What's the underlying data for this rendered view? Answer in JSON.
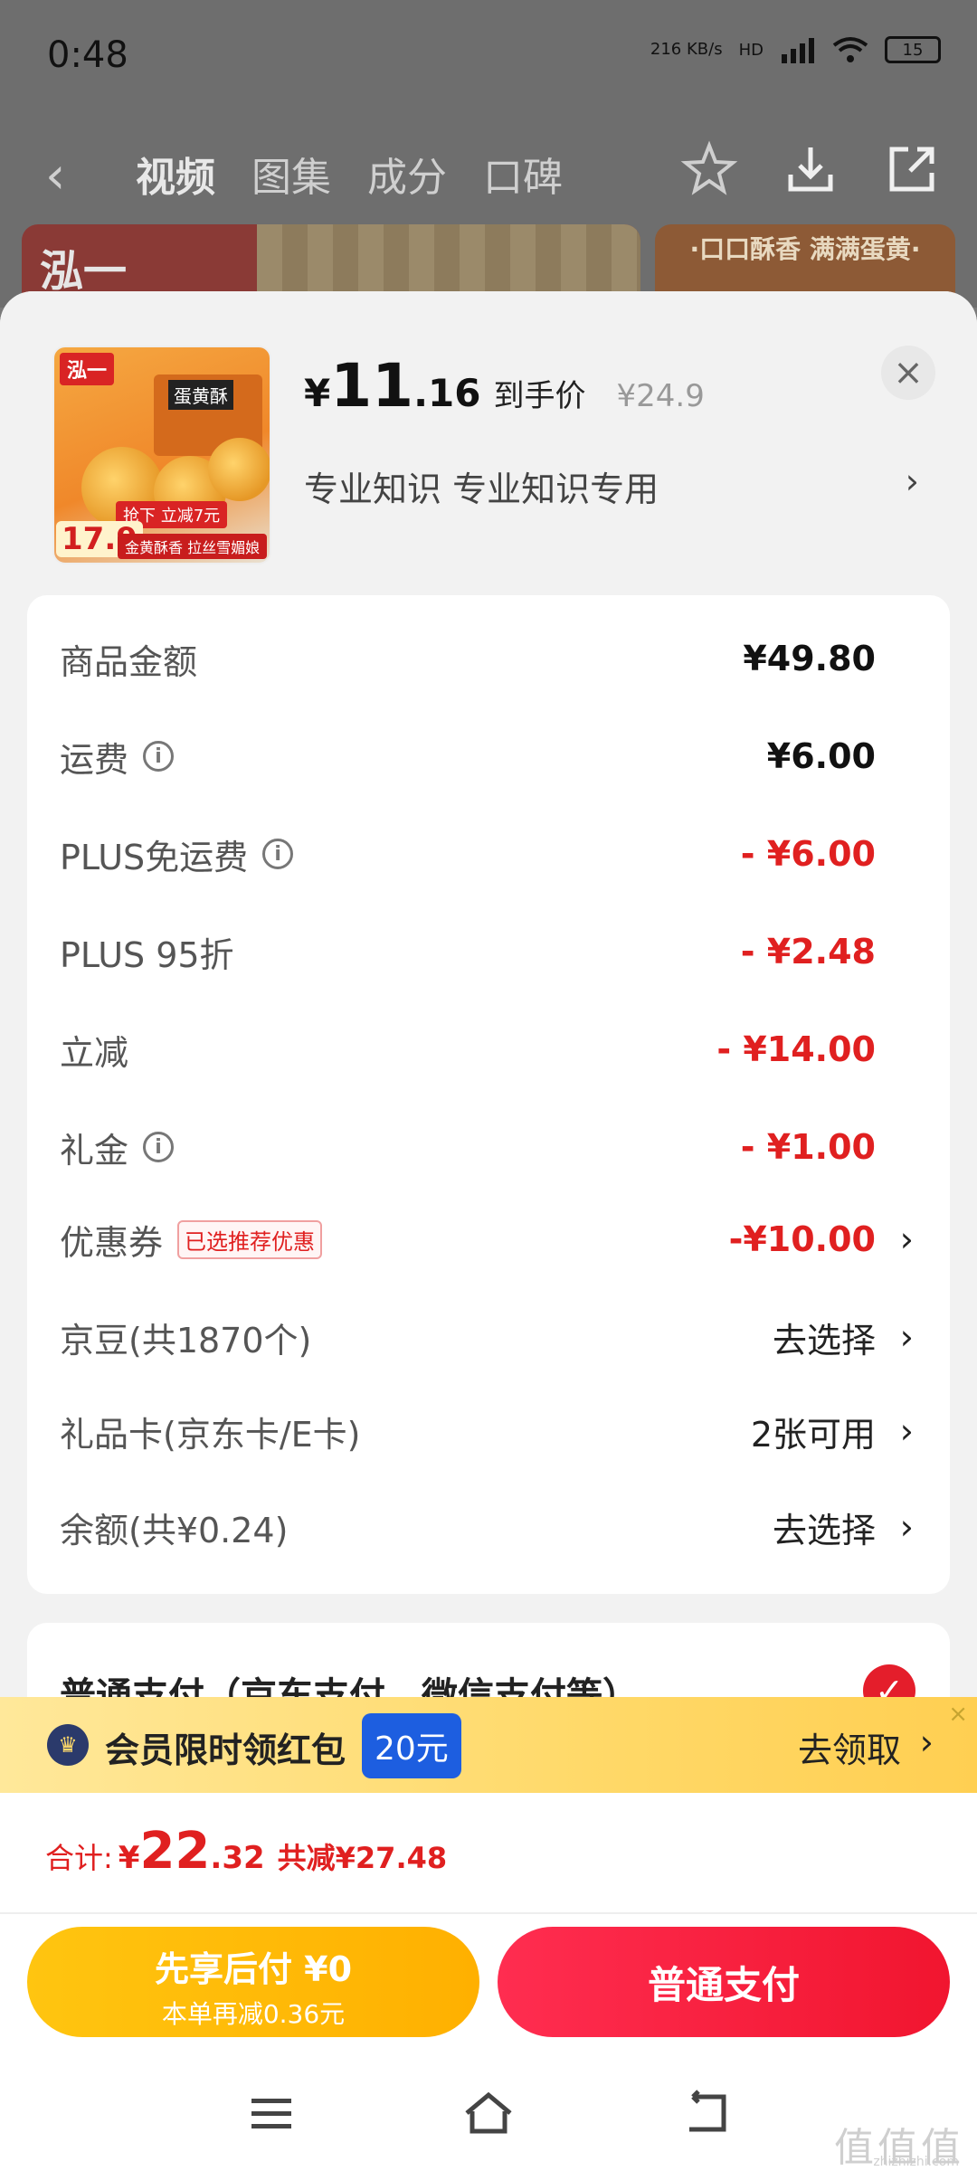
{
  "status_bar": {
    "time": "0:48",
    "speed": "216 KB/s",
    "network": "HD",
    "battery": "15"
  },
  "nav": {
    "back_glyph": "‹",
    "tabs": [
      {
        "label": "视频",
        "active": true
      },
      {
        "label": "图集",
        "active": false
      },
      {
        "label": "成分",
        "active": false
      },
      {
        "label": "口碑",
        "active": false
      }
    ],
    "icons": [
      "star-icon",
      "download-icon",
      "share-icon"
    ]
  },
  "background_banner": {
    "logo": "泓一",
    "right_text": "·口口酥香 满满蛋黄·"
  },
  "product": {
    "thumb": {
      "logo": "泓一",
      "box_label": "蛋黄酥",
      "price": "17.9",
      "tag": "抢下 立减7元",
      "tag2": "金黄酥香  拉丝雪媚娘"
    },
    "price_yen": "¥",
    "price_int": "11",
    "price_dec": ".16",
    "price_label": "到手价",
    "original_price": "¥24.9",
    "subtitle": "专业知识  专业知识专用",
    "subtitle_chevron": "›",
    "close": "×"
  },
  "details": {
    "rows": [
      {
        "label": "商品金额",
        "info": false,
        "value": "¥49.80",
        "style": "bold"
      },
      {
        "label": "运费",
        "info": true,
        "value": "¥6.00",
        "style": "bold"
      },
      {
        "label": "PLUS免运费",
        "info": true,
        "value": "- ¥6.00",
        "style": "red"
      },
      {
        "label": "PLUS 95折",
        "info": false,
        "value": "- ¥2.48",
        "style": "red"
      },
      {
        "label": "立减",
        "info": false,
        "value": "- ¥14.00",
        "style": "red"
      },
      {
        "label": "礼金",
        "info": true,
        "value": "- ¥1.00",
        "style": "red"
      },
      {
        "label": "优惠券",
        "tag": "已选推荐优惠",
        "value": "-¥10.00",
        "style": "red",
        "chevron": true
      },
      {
        "label": "京豆(共1870个)",
        "value": "去选择",
        "style": "normal",
        "chevron": true
      },
      {
        "label": "礼品卡(京东卡/E卡)",
        "value": "2张可用",
        "style": "normal",
        "chevron": true
      },
      {
        "label": "余额(共¥0.24)",
        "value": "去选择",
        "style": "normal",
        "chevron": true
      }
    ],
    "info_glyph": "i",
    "chevron_glyph": "›"
  },
  "payment_method": {
    "title": "普通支付（京东支付、微信支付等）",
    "check": "✓"
  },
  "promo": {
    "icon_glyph": "♛",
    "text": "会员限时领红包",
    "badge": "20元",
    "action": "去领取",
    "chevron": "›",
    "close": "×"
  },
  "total": {
    "label": "合计:",
    "yen": "¥",
    "int": "22",
    "dec": ".32",
    "saved": "共减¥27.48"
  },
  "actions": {
    "later_main": "先享后付 ¥0",
    "later_sub": "本单再减0.36元",
    "pay": "普通支付"
  },
  "watermark": {
    "main": "值值值",
    "sub": "zhizhizhi.com"
  },
  "colors": {
    "accent_red": "#e02020",
    "pay_red": "#f1152f",
    "later_yellow": "#ffb000",
    "promo_blue": "#1d5ee0"
  }
}
